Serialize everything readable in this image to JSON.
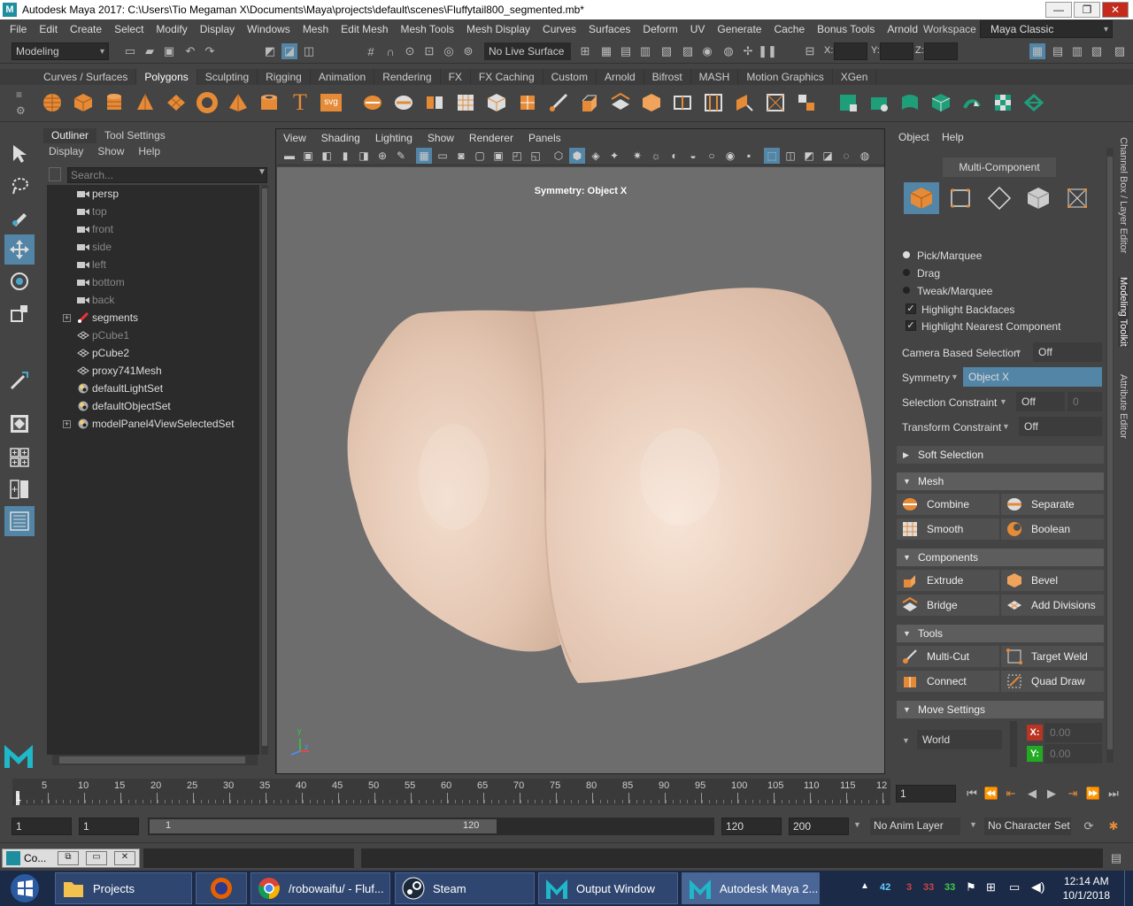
{
  "title_bar": {
    "text": "Autodesk Maya 2017: C:\\Users\\Tio Megaman X\\Documents\\Maya\\projects\\default\\scenes\\Fluffytail800_segmented.mb*",
    "icon": "M",
    "minimize": "—",
    "maximize": "❐",
    "close": "✕"
  },
  "menu": [
    "File",
    "Edit",
    "Create",
    "Select",
    "Modify",
    "Display",
    "Windows",
    "Mesh",
    "Edit Mesh",
    "Mesh Tools",
    "Mesh Display",
    "Curves",
    "Surfaces",
    "Deform",
    "UV",
    "Generate",
    "Cache",
    "Bonus Tools",
    "Arnold"
  ],
  "workspace": {
    "label": "Workspace :",
    "value": "Maya Classic"
  },
  "status_line": {
    "mode": "Modeling",
    "live_surface": "No Live Surface",
    "x_label": "X:",
    "y_label": "Y:",
    "z_label": "Z:"
  },
  "shelf_tabs": [
    "Curves / Surfaces",
    "Polygons",
    "Sculpting",
    "Rigging",
    "Animation",
    "Rendering",
    "FX",
    "FX Caching",
    "Custom",
    "Arnold",
    "Bifrost",
    "MASH",
    "Motion Graphics",
    "XGen"
  ],
  "shelf_active": "Polygons",
  "shelf_text_icons": {
    "type_tool": "T",
    "svg_tool": "svg"
  },
  "outliner": {
    "tabs": [
      "Outliner",
      "Tool Settings"
    ],
    "menu": [
      "Display",
      "Show",
      "Help"
    ],
    "search_placeholder": "Search...",
    "items": [
      {
        "label": "persp",
        "icon": "camera-icon",
        "dim": false,
        "expandable": false
      },
      {
        "label": "top",
        "icon": "camera-icon",
        "dim": true,
        "expandable": false
      },
      {
        "label": "front",
        "icon": "camera-icon",
        "dim": true,
        "expandable": false
      },
      {
        "label": "side",
        "icon": "camera-icon",
        "dim": true,
        "expandable": false
      },
      {
        "label": "left",
        "icon": "camera-icon",
        "dim": true,
        "expandable": false
      },
      {
        "label": "bottom",
        "icon": "camera-icon",
        "dim": true,
        "expandable": false
      },
      {
        "label": "back",
        "icon": "camera-icon",
        "dim": true,
        "expandable": false
      },
      {
        "label": "segments",
        "icon": "joint-icon",
        "dim": false,
        "expandable": true
      },
      {
        "label": "pCube1",
        "icon": "mesh-icon",
        "dim": true,
        "expandable": false
      },
      {
        "label": "pCube2",
        "icon": "mesh-icon",
        "dim": false,
        "expandable": false
      },
      {
        "label": "proxy741Mesh",
        "icon": "mesh-icon",
        "dim": false,
        "expandable": false
      },
      {
        "label": "defaultLightSet",
        "icon": "set-icon",
        "dim": false,
        "expandable": false
      },
      {
        "label": "defaultObjectSet",
        "icon": "set-icon",
        "dim": false,
        "expandable": false
      },
      {
        "label": "modelPanel4ViewSelectedSet",
        "icon": "set-icon",
        "dim": false,
        "expandable": true
      }
    ]
  },
  "viewport": {
    "menu": [
      "View",
      "Shading",
      "Lighting",
      "Show",
      "Renderer",
      "Panels"
    ],
    "symmetry_label": "Symmetry: Object X",
    "axis_y": "y",
    "axis_z": "z"
  },
  "modeling_toolkit": {
    "menu": [
      "Object",
      "Help"
    ],
    "mode_title": "Multi-Component",
    "radios": [
      {
        "label": "Pick/Marquee",
        "on": true
      },
      {
        "label": "Drag",
        "on": false
      },
      {
        "label": "Tweak/Marquee",
        "on": false
      }
    ],
    "checkboxes": [
      {
        "label": "Highlight Backfaces",
        "checked": true
      },
      {
        "label": "Highlight Nearest Component",
        "checked": true
      }
    ],
    "check_glyph": "✓",
    "camera_based_selection": {
      "label": "Camera Based Selection",
      "value": "Off"
    },
    "symmetry": {
      "label": "Symmetry",
      "value": "Object X"
    },
    "selection_constraint": {
      "label": "Selection Constraint",
      "value": "Off",
      "count": "0"
    },
    "transform_constraint": {
      "label": "Transform Constraint",
      "value": "Off"
    },
    "soft_selection": "Soft Selection",
    "mesh_section": {
      "title": "Mesh",
      "buttons": [
        "Combine",
        "Separate",
        "Smooth",
        "Boolean"
      ]
    },
    "components_section": {
      "title": "Components",
      "buttons": [
        "Extrude",
        "Bevel",
        "Bridge",
        "Add Divisions"
      ]
    },
    "tools_section": {
      "title": "Tools",
      "buttons": [
        "Multi-Cut",
        "Target Weld",
        "Connect",
        "Quad Draw"
      ]
    },
    "move_settings": {
      "title": "Move Settings",
      "space": "World",
      "x_label": "X:",
      "y_label": "Y:",
      "x_value": "0.00",
      "y_value": "0.00"
    }
  },
  "side_tabs": [
    "Channel Box / Layer Editor",
    "Modeling Toolkit",
    "Attribute Editor"
  ],
  "timeline": {
    "ticks": [
      "5",
      "10",
      "15",
      "20",
      "25",
      "30",
      "35",
      "40",
      "45",
      "50",
      "55",
      "60",
      "65",
      "70",
      "75",
      "80",
      "85",
      "90",
      "95",
      "100",
      "105",
      "110",
      "115",
      "12"
    ],
    "start_marker": "1",
    "current_frame": "1"
  },
  "range": {
    "start": "1",
    "inner_start": "1",
    "slider_start": "1",
    "slider_end": "120",
    "end": "120",
    "max_end": "200",
    "anim_layer": "No Anim Layer",
    "character_set": "No Character Set"
  },
  "cmdline": {
    "tab_label": "Co..."
  },
  "taskbar": {
    "items": [
      {
        "label": "Projects",
        "icon": "folder-icon"
      },
      {
        "label": "",
        "icon": "firefox-icon"
      },
      {
        "label": "/robowaifu/ - Fluf...",
        "icon": "chrome-icon"
      },
      {
        "label": "Steam",
        "icon": "steam-icon"
      },
      {
        "label": "Output Window",
        "icon": "maya-icon"
      },
      {
        "label": "Autodesk Maya 2...",
        "icon": "maya-icon"
      }
    ],
    "tray_numbers": [
      "42",
      "3",
      "33",
      "33"
    ],
    "time": "12:14 AM",
    "date": "10/1/2018"
  },
  "colors": {
    "accent": "#5285a6",
    "mesh": "#e6cbb8",
    "symmetry_field": "#5285a6"
  }
}
